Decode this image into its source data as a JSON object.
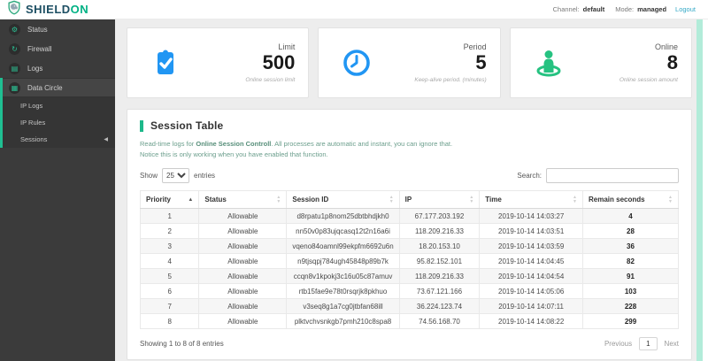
{
  "colors": {
    "accent_green": "#1fbf92",
    "icon_blue": "#2196f3",
    "icon_green": "#26c281",
    "scrollbar_mint": "#b2ecd9"
  },
  "header": {
    "brand_primary": "SHIELD",
    "brand_secondary": "ON",
    "channel_label": "Channel:",
    "channel_value": "default",
    "mode_label": "Mode:",
    "mode_value": "managed",
    "logout_label": "Logout"
  },
  "sidebar": {
    "items": [
      {
        "label": "Status",
        "icon": "gear-icon",
        "glyph": "⚙"
      },
      {
        "label": "Firewall",
        "icon": "firewall-icon",
        "glyph": "↻"
      },
      {
        "label": "Logs",
        "icon": "logs-icon",
        "glyph": "▤"
      },
      {
        "label": "Data Circle",
        "icon": "data-circle-icon",
        "glyph": "▦"
      }
    ],
    "subitems": [
      {
        "label": "IP Logs"
      },
      {
        "label": "IP Rules"
      },
      {
        "label": "Sessions",
        "active": true
      }
    ],
    "collapse_arrow": "◀"
  },
  "cards": [
    {
      "label": "Limit",
      "value": "500",
      "caption": "Online session limit",
      "icon": "clipboard-check-icon"
    },
    {
      "label": "Period",
      "value": "5",
      "caption": "Keep-alive period. (minutes)",
      "icon": "clock-icon"
    },
    {
      "label": "Online",
      "value": "8",
      "caption": "Online session amount",
      "icon": "person-online-icon"
    }
  ],
  "section": {
    "title": "Session Table",
    "desc_pre": "Read-time logs for ",
    "desc_bold": "Online Session Controll",
    "desc_post": ". All processes are automatic and instant, you can ignore that.",
    "desc_line2": "Notice this is only working when you have enabled that function.",
    "show_label": "Show",
    "page_length": "25",
    "entries_label": "entries",
    "search_label": "Search:"
  },
  "table": {
    "columns": [
      "Priority",
      "Status",
      "Session ID",
      "IP",
      "Time",
      "Remain seconds"
    ],
    "rows": [
      {
        "priority": "1",
        "status": "Allowable",
        "session_id": "d8rpatu1p8nom25dbtbhdjkh0",
        "ip": "67.177.203.192",
        "time": "2019-10-14 14:03:27",
        "remain": "4"
      },
      {
        "priority": "2",
        "status": "Allowable",
        "session_id": "nn50v0p83ujqcasq12t2n16a6i",
        "ip": "118.209.216.33",
        "time": "2019-10-14 14:03:51",
        "remain": "28"
      },
      {
        "priority": "3",
        "status": "Allowable",
        "session_id": "vqeno84oamnl99ekpfm6692u6n",
        "ip": "18.20.153.10",
        "time": "2019-10-14 14:03:59",
        "remain": "36"
      },
      {
        "priority": "4",
        "status": "Allowable",
        "session_id": "n9tjsqpj784ugh45848p89b7k",
        "ip": "95.82.152.101",
        "time": "2019-10-14 14:04:45",
        "remain": "82"
      },
      {
        "priority": "5",
        "status": "Allowable",
        "session_id": "ccqn8v1kpokj3c16u05c87amuv",
        "ip": "118.209.216.33",
        "time": "2019-10-14 14:04:54",
        "remain": "91"
      },
      {
        "priority": "6",
        "status": "Allowable",
        "session_id": "rtb15fae9e78t0rsqrjk8pkhuo",
        "ip": "73.67.121.166",
        "time": "2019-10-14 14:05:06",
        "remain": "103"
      },
      {
        "priority": "7",
        "status": "Allowable",
        "session_id": "v3seq8g1a7cg0jtbfan68ill",
        "ip": "36.224.123.74",
        "time": "2019-10-14 14:07:11",
        "remain": "228"
      },
      {
        "priority": "8",
        "status": "Allowable",
        "session_id": "plktvchvsnkgb7pmh210c8spa8",
        "ip": "74.56.168.70",
        "time": "2019-10-14 14:08:22",
        "remain": "299"
      }
    ]
  },
  "footer": {
    "showing_text": "Showing 1 to 8 of 8 entries",
    "previous_label": "Previous",
    "page_number": "1",
    "next_label": "Next"
  }
}
